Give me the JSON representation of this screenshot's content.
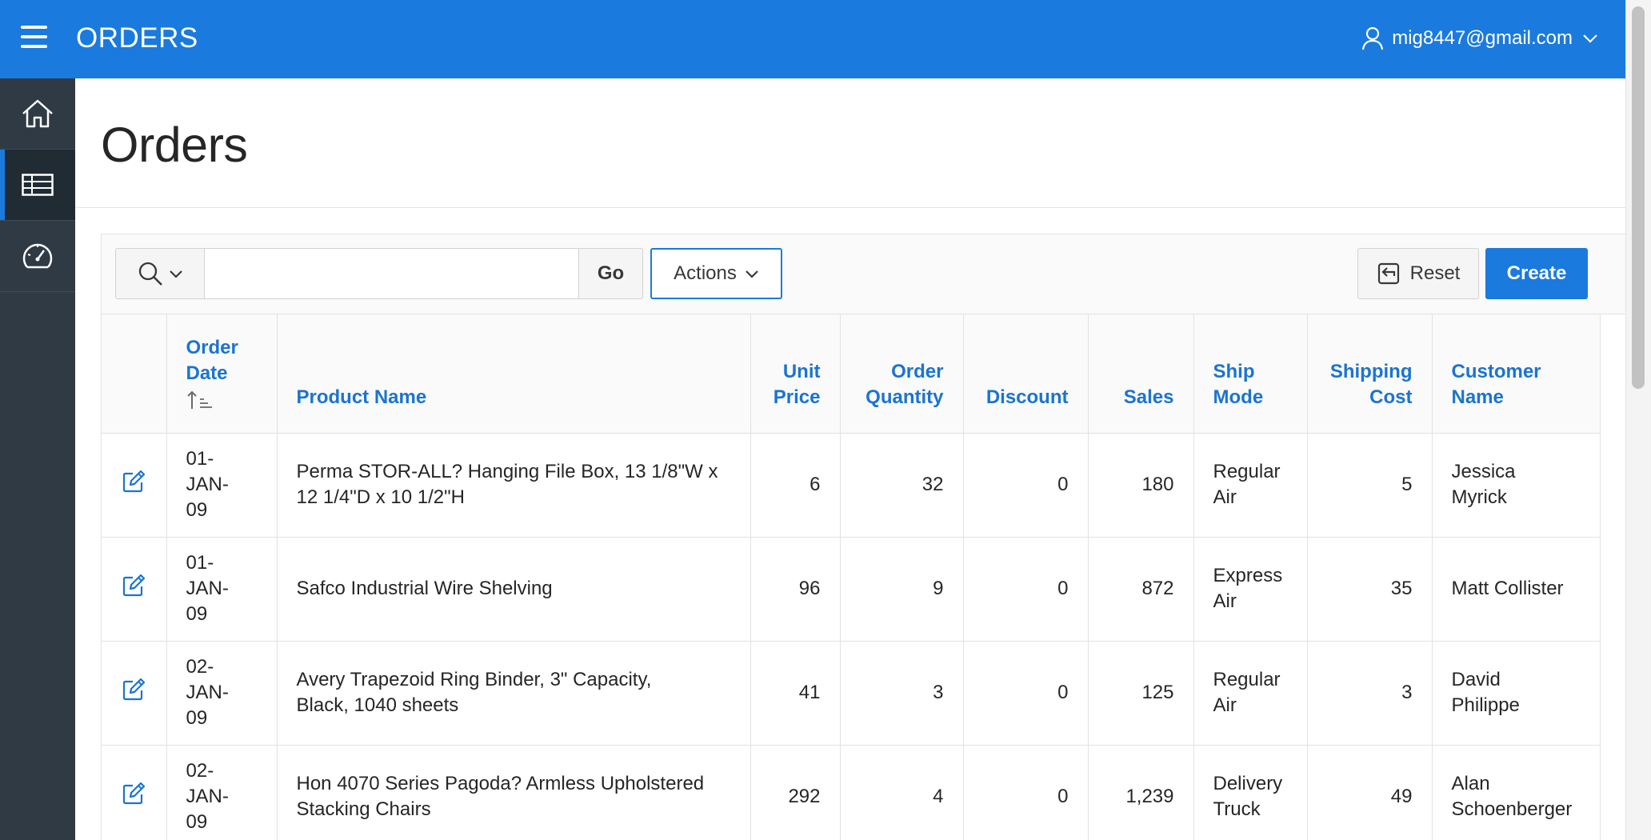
{
  "header": {
    "app_title": "ORDERS",
    "user": "mig8447@gmail.com"
  },
  "nav": {
    "items": [
      {
        "icon": "home-icon",
        "active": false
      },
      {
        "icon": "table-icon",
        "active": true
      },
      {
        "icon": "dashboard-gauge-icon",
        "active": false
      }
    ]
  },
  "page": {
    "title": "Orders"
  },
  "toolbar": {
    "search_value": "",
    "go_label": "Go",
    "actions_label": "Actions",
    "reset_label": "Reset",
    "create_label": "Create"
  },
  "table": {
    "columns": {
      "order_date_l1": "Order",
      "order_date_l2": "Date",
      "product_name": "Product Name",
      "unit_price_l1": "Unit",
      "unit_price_l2": "Price",
      "order_quantity_l1": "Order",
      "order_quantity_l2": "Quantity",
      "discount": "Discount",
      "sales": "Sales",
      "ship_mode_l1": "Ship",
      "ship_mode_l2": "Mode",
      "shipping_cost_l1": "Shipping",
      "shipping_cost_l2": "Cost",
      "customer_name_l1": "Customer",
      "customer_name_l2": "Name"
    },
    "sort": "ascending",
    "rows": [
      {
        "date_l1": "01-",
        "date_l2": "JAN-",
        "date_l3": "09",
        "product_l1": "Perma STOR-ALL? Hanging File Box, 13 1/8\"W x",
        "product_l2": "12 1/4\"D x 10 1/2\"H",
        "unit_price": "6",
        "quantity": "32",
        "discount": "0",
        "sales": "180",
        "ship_l1": "Regular",
        "ship_l2": "Air",
        "shipping_cost": "5",
        "customer_l1": "Jessica",
        "customer_l2": "Myrick"
      },
      {
        "date_l1": "01-",
        "date_l2": "JAN-",
        "date_l3": "09",
        "product_l1": "Safco Industrial Wire Shelving",
        "product_l2": "",
        "unit_price": "96",
        "quantity": "9",
        "discount": "0",
        "sales": "872",
        "ship_l1": "Express",
        "ship_l2": "Air",
        "shipping_cost": "35",
        "customer_l1": "Matt Collister",
        "customer_l2": ""
      },
      {
        "date_l1": "02-",
        "date_l2": "JAN-",
        "date_l3": "09",
        "product_l1": "Avery Trapezoid Ring Binder, 3\" Capacity,",
        "product_l2": "Black, 1040 sheets",
        "unit_price": "41",
        "quantity": "3",
        "discount": "0",
        "sales": "125",
        "ship_l1": "Regular",
        "ship_l2": "Air",
        "shipping_cost": "3",
        "customer_l1": "David",
        "customer_l2": "Philippe"
      },
      {
        "date_l1": "02-",
        "date_l2": "JAN-",
        "date_l3": "09",
        "product_l1": "Hon 4070 Series Pagoda? Armless Upholstered",
        "product_l2": "Stacking Chairs",
        "unit_price": "292",
        "quantity": "4",
        "discount": "0",
        "sales": "1,239",
        "ship_l1": "Delivery",
        "ship_l2": "Truck",
        "shipping_cost": "49",
        "customer_l1": "Alan",
        "customer_l2": "Schoenberger"
      }
    ]
  },
  "colors": {
    "header_bg": "#1a7ade",
    "nav_bg": "#2f3a45",
    "link_blue": "#1a74d1"
  }
}
